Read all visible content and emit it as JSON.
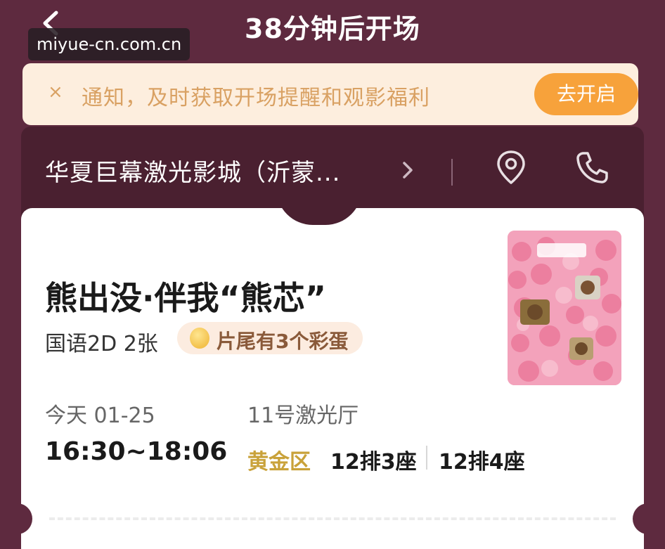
{
  "header": {
    "title": "38分钟后开场",
    "watermark": "miyue-cn.com.cn"
  },
  "notice": {
    "close_icon": "×",
    "text": "通知，及时获取开场提醒和观影福利",
    "button_label": "去开启"
  },
  "cinema": {
    "name": "华夏巨幕激光影城（沂蒙..."
  },
  "movie": {
    "title": "熊出没·伴我“熊芯”",
    "meta": "国语2D 2张",
    "egg_tag": "片尾有3个彩蛋",
    "date": "今天 01-25",
    "time": "16:30~18:06",
    "hall": "11号激光厅",
    "zone": "黄金区",
    "seats": [
      "12排3座",
      "12排4座"
    ]
  },
  "colors": {
    "background": "#5e2a3f",
    "cinema_bar": "#4a2030",
    "notice_bg": "#fdeede",
    "notice_text": "#d9a163",
    "accent_button": "#f7a23b",
    "zone_text": "#c9a23a"
  },
  "icons": {
    "back": "chevron-left-icon",
    "chevron": "chevron-right-icon",
    "location": "location-pin-icon",
    "phone": "phone-icon",
    "egg": "egg-icon"
  }
}
